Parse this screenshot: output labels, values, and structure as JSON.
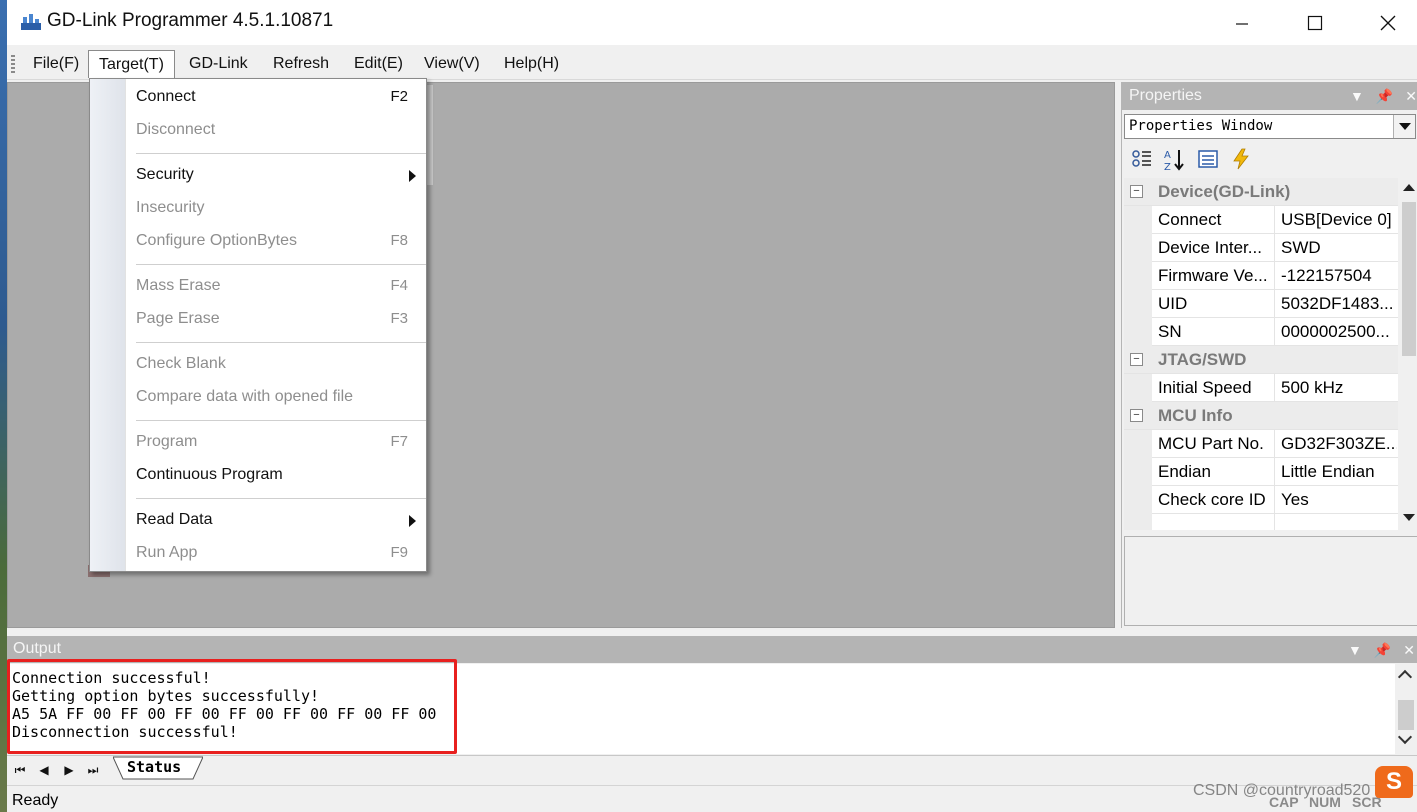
{
  "window": {
    "title": "GD-Link Programmer 4.5.1.10871",
    "minimize_icon": "minimize-icon",
    "maximize_icon": "maximize-icon",
    "close_icon": "close-icon"
  },
  "menubar": {
    "items": [
      {
        "label": "File(F)"
      },
      {
        "label": "Target(T)"
      },
      {
        "label": "GD-Link"
      },
      {
        "label": "Refresh"
      },
      {
        "label": "Edit(E)"
      },
      {
        "label": "View(V)"
      },
      {
        "label": "Help(H)"
      }
    ],
    "open_menu": "Target(T)"
  },
  "target_menu": {
    "items": [
      {
        "label": "Connect",
        "shortcut": "F2",
        "enabled": true
      },
      {
        "label": "Disconnect",
        "shortcut": "",
        "enabled": false
      },
      {
        "label": "Security",
        "shortcut": "",
        "enabled": true,
        "submenu": true
      },
      {
        "label": "Insecurity",
        "shortcut": "",
        "enabled": false
      },
      {
        "label": "Configure OptionBytes",
        "shortcut": "F8",
        "enabled": false
      },
      {
        "label": "Mass Erase",
        "shortcut": "F4",
        "enabled": false
      },
      {
        "label": "Page Erase",
        "shortcut": "F3",
        "enabled": false
      },
      {
        "label": "Check Blank",
        "shortcut": "",
        "enabled": false
      },
      {
        "label": "Compare data with opened file",
        "shortcut": "",
        "enabled": false
      },
      {
        "label": "Program",
        "shortcut": "F7",
        "enabled": false
      },
      {
        "label": "Continuous Program",
        "shortcut": "",
        "enabled": true
      },
      {
        "label": "Read Data",
        "shortcut": "",
        "enabled": true,
        "submenu": true
      },
      {
        "label": "Run App",
        "shortcut": "F9",
        "enabled": false
      }
    ]
  },
  "properties": {
    "title": "Properties",
    "selector_value": "Properties Window",
    "toolbar_icons": [
      "categorized-icon",
      "alphabetical-sort-icon",
      "property-pages-icon",
      "events-icon"
    ],
    "categories": [
      {
        "name": "Device(GD-Link)",
        "rows": [
          {
            "name": "Connect",
            "value": "USB[Device 0]"
          },
          {
            "name": "Device Inter...",
            "value": "SWD"
          },
          {
            "name": "Firmware Ve...",
            "value": "-122157504"
          },
          {
            "name": "UID",
            "value": "5032DF1483..."
          },
          {
            "name": "SN",
            "value": "0000002500..."
          }
        ]
      },
      {
        "name": "JTAG/SWD",
        "rows": [
          {
            "name": "Initial Speed",
            "value": "500 kHz"
          }
        ]
      },
      {
        "name": "MCU Info",
        "rows": [
          {
            "name": "MCU Part No.",
            "value": "GD32F303ZE..."
          },
          {
            "name": "Endian",
            "value": "Little Endian"
          },
          {
            "name": "Check core ID",
            "value": "Yes"
          }
        ]
      }
    ]
  },
  "output": {
    "title": "Output",
    "lines": [
      "Connection successful!",
      "Getting option bytes successfully!",
      "A5 5A FF 00 FF 00 FF 00 FF 00 FF 00 FF 00 FF 00",
      "Disconnection successful!"
    ],
    "highlight_color": "#e8201f"
  },
  "tabs": {
    "items": [
      {
        "label": "Status"
      }
    ],
    "nav_icons": [
      "first-page-icon",
      "prev-page-icon",
      "next-page-icon",
      "last-page-icon"
    ]
  },
  "statusbar": {
    "text": "Ready",
    "indicators": [
      "CAP",
      "NUM",
      "SCR"
    ]
  },
  "watermark": "CSDN @countryroad520",
  "ime_badge": "S"
}
